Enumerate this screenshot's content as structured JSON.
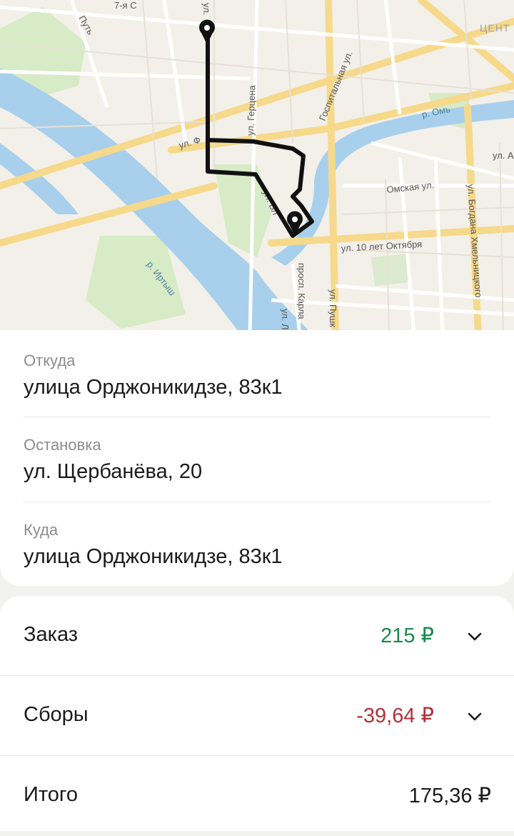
{
  "map": {
    "labels": {
      "put": "Путь",
      "seventh": "7-я С",
      "center": "ЦЕНТ",
      "hospital": "Госпитальная ул.",
      "herzen": "ул. Герцена",
      "omsk_river": "р. Омь",
      "ul_a": "ул. А",
      "omskaya": "Омская ул.",
      "frunze": "ул. Ф",
      "bogdan": "ул. Богдана Хмельницкого",
      "karl_marx": "просп. Карла",
      "ten_october": "ул. 10 лет Октября",
      "irtysh": "р. Иртыш",
      "pushkin": "ул. Пушк",
      "ul_l": "ул. Л",
      "lenina": "ул. Бл",
      "ul_top": "ул."
    }
  },
  "route": {
    "from_label": "Откуда",
    "from_value": "улица Орджоникидзе, 83к1",
    "stop_label": "Остановка",
    "stop_value": "ул. Щербанёва, 20",
    "to_label": "Куда",
    "to_value": "улица Орджоникидзе, 83к1"
  },
  "pricing": {
    "order_label": "Заказ",
    "order_value": "215 ₽",
    "fees_label": "Сборы",
    "fees_value": "-39,64 ₽",
    "total_label": "Итого",
    "total_value": "175,36 ₽",
    "colors": {
      "positive": "#1a8a4e",
      "negative": "#b3303a"
    }
  }
}
